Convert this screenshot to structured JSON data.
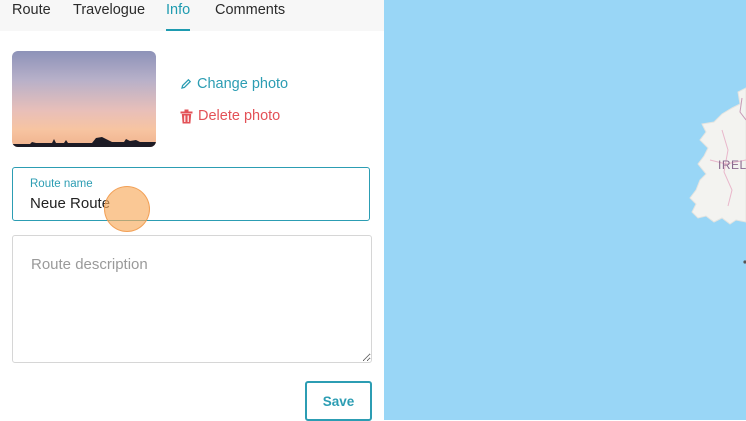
{
  "tabs": [
    {
      "label": "Route",
      "active": false
    },
    {
      "label": "Travelogue",
      "active": false
    },
    {
      "label": "Info",
      "active": true
    },
    {
      "label": "Comments",
      "active": false
    }
  ],
  "photo": {
    "change_label": "Change photo",
    "delete_label": "Delete photo"
  },
  "route_name": {
    "label": "Route name",
    "value": "Neue Route"
  },
  "route_description": {
    "placeholder": "Route description",
    "value": ""
  },
  "save_label": "Save",
  "map": {
    "country_label": "IRELAND"
  },
  "colors": {
    "accent": "#2c9db3",
    "danger": "#e35157",
    "map_water": "#99d6f6"
  }
}
